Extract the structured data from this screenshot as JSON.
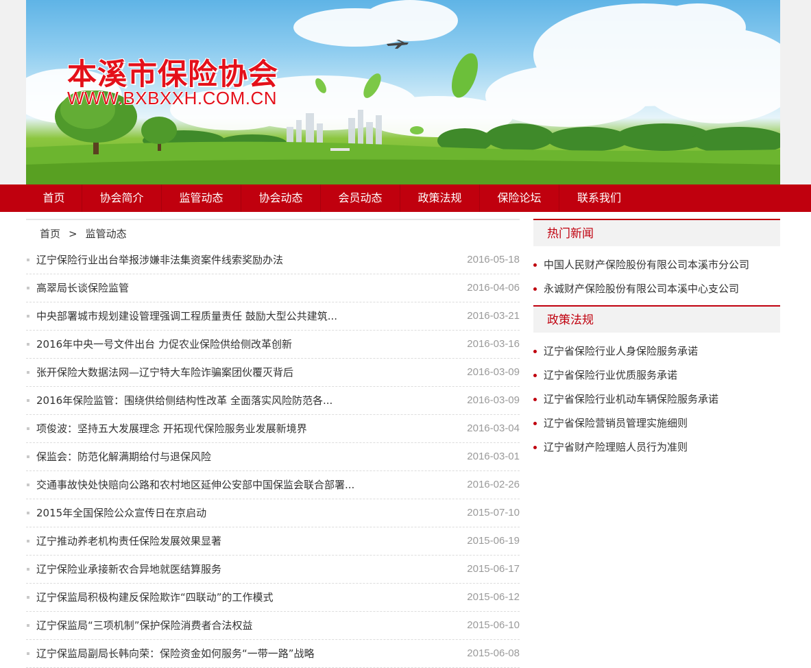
{
  "banner": {
    "title": "本溪市保险协会",
    "url": "WWW.BXBXXH.COM.CN"
  },
  "nav": {
    "items": [
      {
        "label": "首页"
      },
      {
        "label": "协会简介"
      },
      {
        "label": "监管动态"
      },
      {
        "label": "协会动态"
      },
      {
        "label": "会员动态"
      },
      {
        "label": "政策法规"
      },
      {
        "label": "保险论坛"
      },
      {
        "label": "联系我们"
      }
    ]
  },
  "breadcrumb": {
    "home": "首页",
    "separator": ">",
    "current": "监管动态"
  },
  "news": [
    {
      "title": "辽宁保险行业出台举报涉嫌非法集资案件线索奖励办法",
      "date": "2016-05-18"
    },
    {
      "title": "高翠局长谈保险监管",
      "date": "2016-04-06"
    },
    {
      "title": "中央部署城市规划建设管理强调工程质量责任 鼓励大型公共建筑...",
      "date": "2016-03-21"
    },
    {
      "title": "2016年中央一号文件出台 力促农业保险供给侧改革创新",
      "date": "2016-03-16"
    },
    {
      "title": "张开保险大数据法网—辽宁特大车险诈骗案团伙覆灭背后",
      "date": "2016-03-09"
    },
    {
      "title": "2016年保险监管：围绕供给侧结构性改革 全面落实风险防范各...",
      "date": "2016-03-09"
    },
    {
      "title": "项俊波：坚持五大发展理念 开拓现代保险服务业发展新境界",
      "date": "2016-03-04"
    },
    {
      "title": "保监会：防范化解满期给付与退保风险",
      "date": "2016-03-01"
    },
    {
      "title": "交通事故快处快赔向公路和农村地区延伸公安部中国保监会联合部署...",
      "date": "2016-02-26"
    },
    {
      "title": "2015年全国保险公众宣传日在京启动",
      "date": "2015-07-10"
    },
    {
      "title": "辽宁推动养老机构责任保险发展效果显著",
      "date": "2015-06-19"
    },
    {
      "title": "辽宁保险业承接新农合异地就医结算服务",
      "date": "2015-06-17"
    },
    {
      "title": "辽宁保监局积极构建反保险欺诈“四联动”的工作模式",
      "date": "2015-06-12"
    },
    {
      "title": "辽宁保监局“三项机制”保护保险消费者合法权益",
      "date": "2015-06-10"
    },
    {
      "title": "辽宁保监局副局长韩向荣：保险资金如何服务“一带一路”战略",
      "date": "2015-06-08"
    }
  ],
  "sidebar": {
    "hot_news": {
      "heading": "热门新闻",
      "items": [
        "中国人民财产保险股份有限公司本溪市分公司",
        "永诚财产保险股份有限公司本溪中心支公司"
      ]
    },
    "policy": {
      "heading": "政策法规",
      "items": [
        "辽宁省保险行业人身保险服务承诺",
        "辽宁省保险行业优质服务承诺",
        "辽宁省保险行业机动车辆保险服务承诺",
        "辽宁省保险营销员管理实施细则",
        "辽宁省财产险理赔人员行为准则"
      ]
    }
  },
  "colors": {
    "accent": "#c0000e",
    "date": "#9a9a9a"
  }
}
